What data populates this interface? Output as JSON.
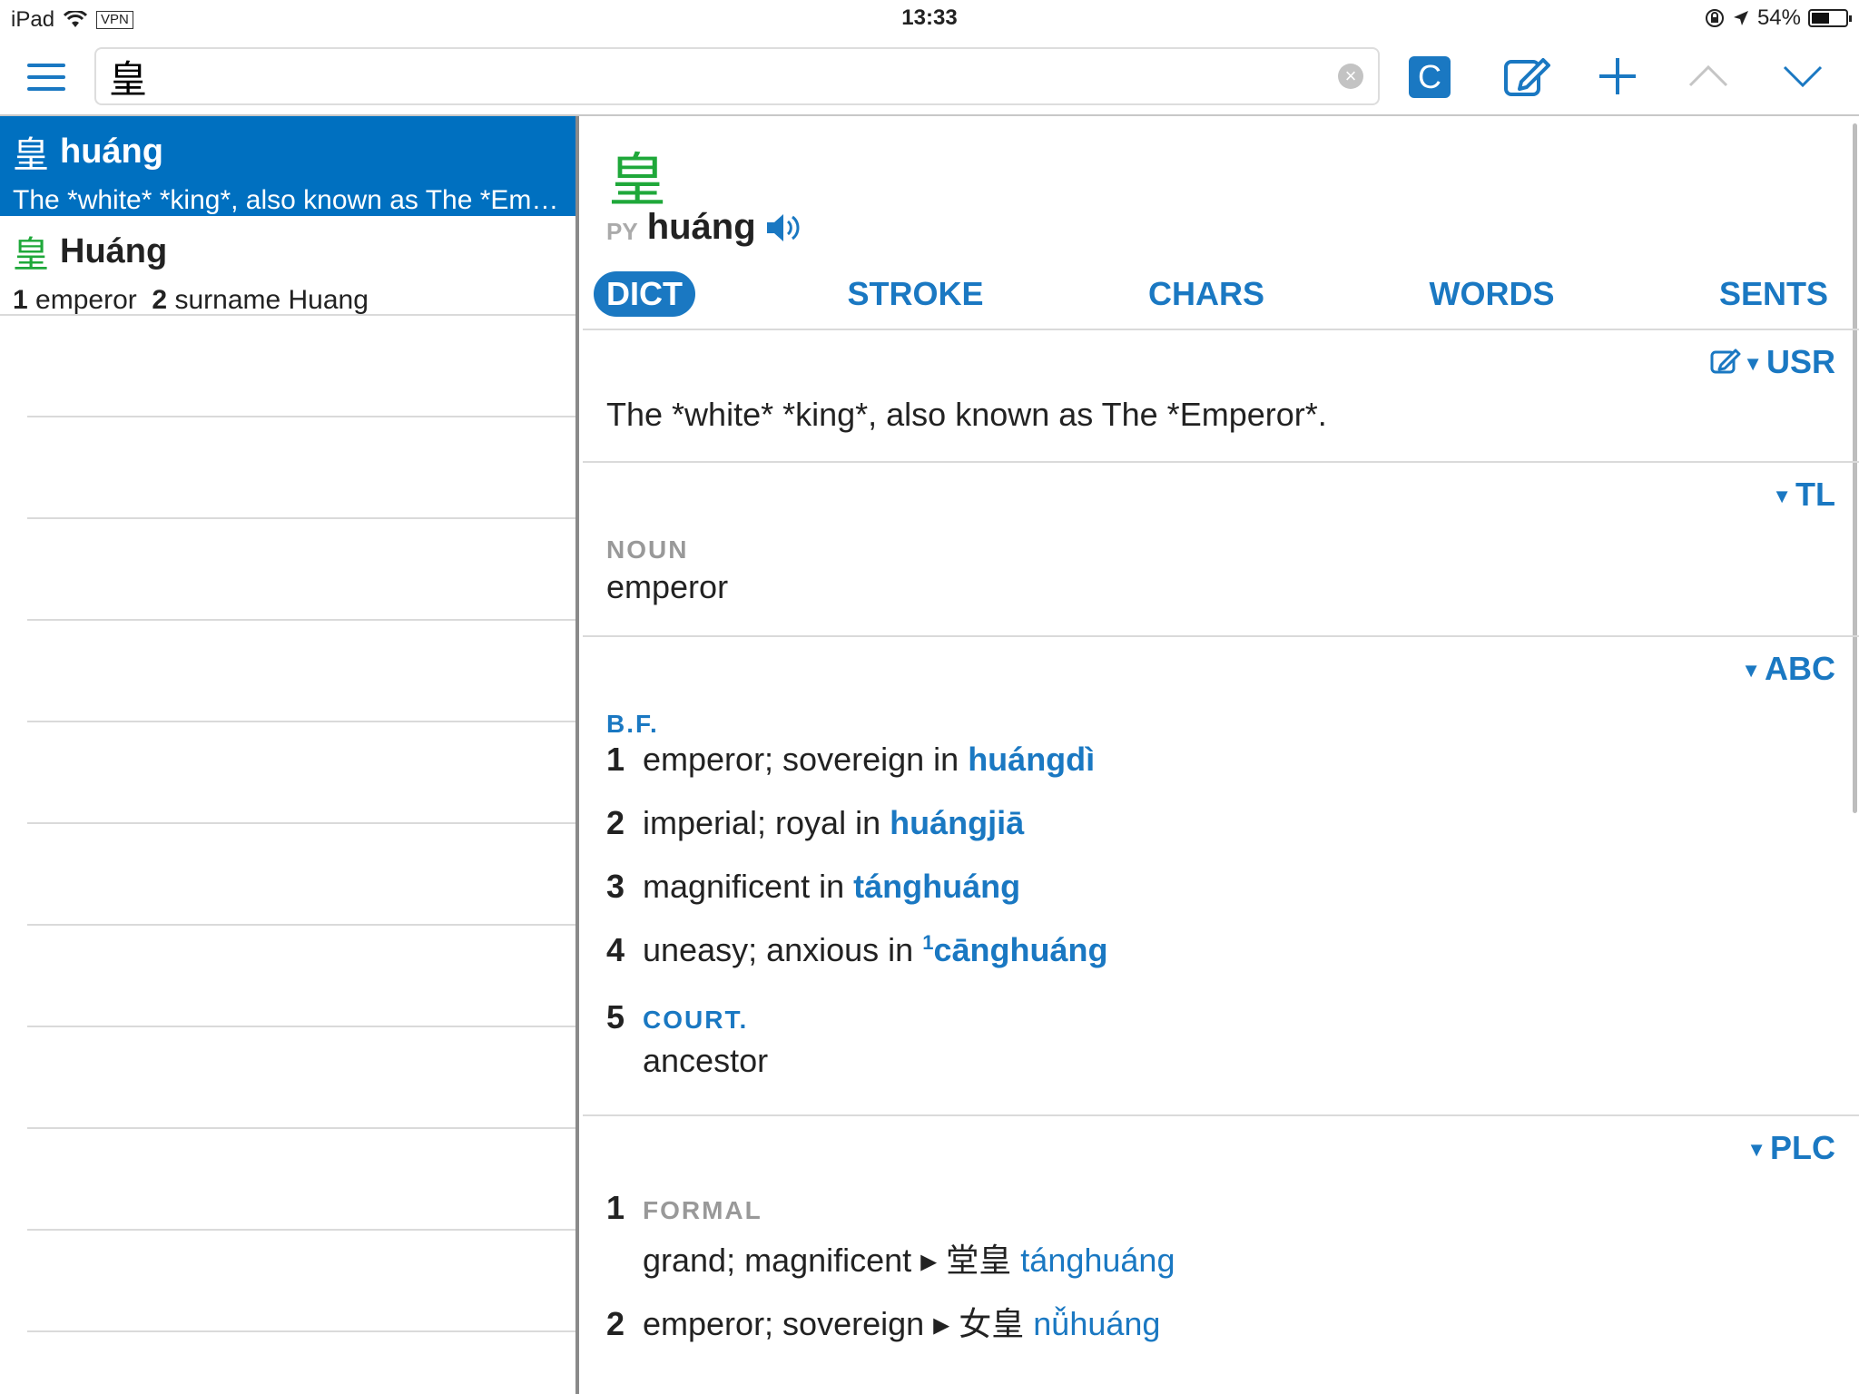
{
  "status": {
    "device": "iPad",
    "vpn": "VPN",
    "time": "13:33",
    "battery": "54%",
    "battery_level": 0.54
  },
  "search": {
    "value": "皇",
    "clear": "×"
  },
  "toolbar": {
    "c_label": "C"
  },
  "results": [
    {
      "hz": "皇",
      "py": "huáng",
      "def": "The *white* *king*, also known as The *Em…",
      "selected": true
    },
    {
      "hz": "皇",
      "py": "Huáng",
      "n1": "1",
      "d1": "emperor",
      "n2": "2",
      "d2": "surname Huang"
    }
  ],
  "entry": {
    "headword": "皇",
    "py_label": "PY",
    "pinyin": "huáng",
    "tabs": [
      "DICT",
      "STROKE",
      "CHARS",
      "WORDS",
      "SENTS"
    ],
    "usr": {
      "tag": "USR",
      "text": "The *white* *king*, also known as The *Emperor*."
    },
    "tl": {
      "tag": "TL",
      "pos": "NOUN",
      "text": "emperor"
    },
    "abc": {
      "tag": "ABC",
      "pos": "B.F.",
      "senses": [
        {
          "n": "1",
          "text": "emperor; sovereign in",
          "link": "huángdì"
        },
        {
          "n": "2",
          "text": "imperial; royal in",
          "link": "huángjiā"
        },
        {
          "n": "3",
          "text": "magnificent in",
          "link": "tánghuáng"
        },
        {
          "n": "4",
          "text": "uneasy; anxious in",
          "sup": "1",
          "link": "cānghuáng"
        },
        {
          "n": "5",
          "label": "COURT.",
          "text": "ancestor"
        }
      ]
    },
    "plc": {
      "tag": "PLC",
      "senses": [
        {
          "n": "1",
          "label": "FORMAL",
          "text": "grand; magnificent ▸",
          "hz": "堂皇",
          "link": "tánghuáng"
        },
        {
          "n": "2",
          "text": "emperor; sovereign ▸",
          "hz": "女皇",
          "link": "nǚhuáng"
        }
      ]
    }
  }
}
